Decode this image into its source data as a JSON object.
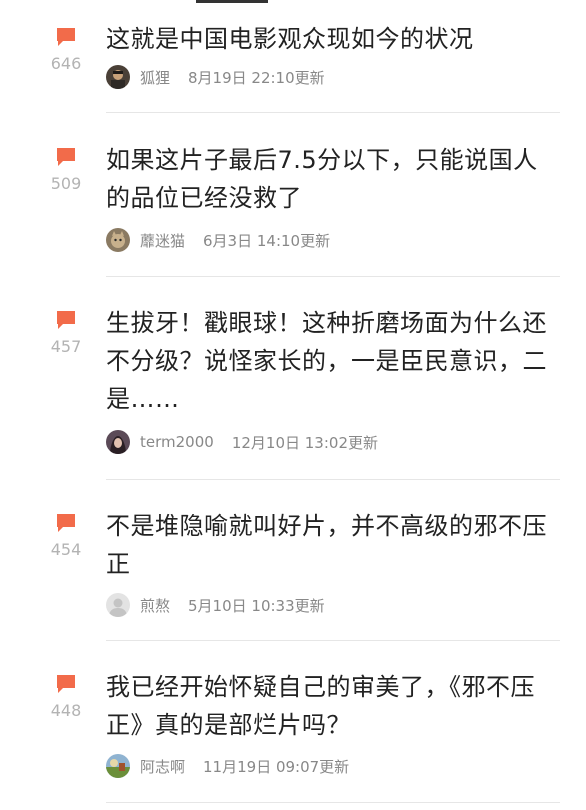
{
  "colors": {
    "vote_icon": "#f26b4a",
    "vote_count": "#b3b3b3",
    "meta_text": "#888888",
    "comment_text": "#222222",
    "divider": "#e6e6e6"
  },
  "comments": [
    {
      "vote_count": "646",
      "text": "这就是中国电影观众现如今的状况",
      "username": "狐狸",
      "timestamp": "8月19日 22:10更新",
      "avatar_icon": "avatar-fox-photo-icon"
    },
    {
      "vote_count": "509",
      "text": "如果这片子最后7.5分以下，只能说国人的品位已经没救了",
      "username": "蘼迷猫",
      "timestamp": "6月3日 14:10更新",
      "avatar_icon": "avatar-cat-photo-icon"
    },
    {
      "vote_count": "457",
      "text": "生拔牙！戳眼球！这种折磨场面为什么还不分级？说怪家长的，一是臣民意识，二是……",
      "username": "term2000",
      "timestamp": "12月10日 13:02更新",
      "avatar_icon": "avatar-person-photo-icon"
    },
    {
      "vote_count": "454",
      "text": "不是堆隐喻就叫好片，并不高级的邪不压正",
      "username": "煎熬",
      "timestamp": "5月10日 10:33更新",
      "avatar_icon": "avatar-default-user-icon"
    },
    {
      "vote_count": "448",
      "text": "我已经开始怀疑自己的审美了，《邪不压正》真的是部烂片吗？",
      "username": "阿志啊",
      "timestamp": "11月19日 09:07更新",
      "avatar_icon": "avatar-landscape-photo-icon"
    }
  ]
}
